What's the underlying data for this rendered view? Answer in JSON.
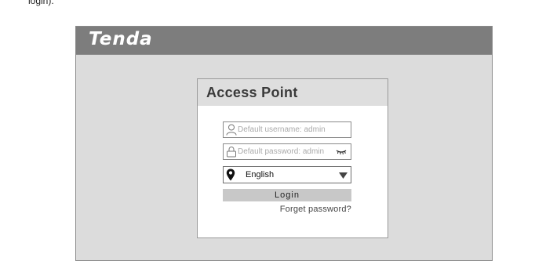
{
  "caption": "login).",
  "app": {
    "logo_text": "Tenda"
  },
  "login": {
    "title": "Access Point",
    "username_placeholder": "Default username: admin",
    "password_placeholder": "Default password: admin",
    "language": "English",
    "login_label": "Login",
    "forget_label": "Forget password?"
  },
  "icons": {
    "username": "user-icon",
    "password": "lock-icon",
    "show_password": "eye-closed-icon",
    "language": "location-pin-icon",
    "dropdown": "chevron-down-icon"
  },
  "colors": {
    "titlebar": "#7d7d7d",
    "window_bg": "#dcdcdc",
    "button": "#c8c8c8"
  }
}
